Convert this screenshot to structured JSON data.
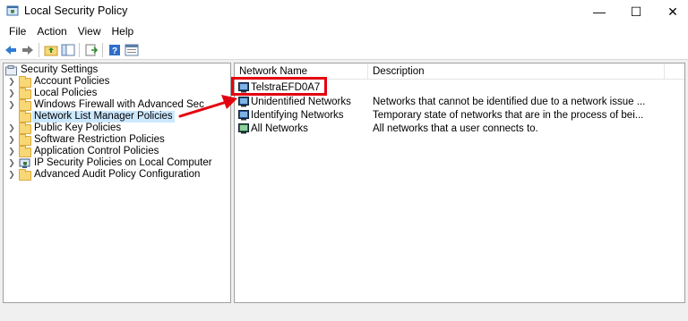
{
  "window": {
    "title": "Local Security Policy",
    "controls": {
      "minimize": "—",
      "maximize": "☐",
      "close": "✕"
    }
  },
  "menu": [
    "File",
    "Action",
    "View",
    "Help"
  ],
  "toolbar": {
    "buttons": [
      "back-arrow-icon",
      "forward-arrow-icon",
      "up-folder-icon",
      "show-hide-tree-icon",
      "export-list-icon",
      "help-icon",
      "properties-icon"
    ]
  },
  "tree": {
    "root": "Security Settings",
    "items": [
      "Account Policies",
      "Local Policies",
      "Windows Firewall with Advanced Sec",
      "Network List Manager Policies",
      "Public Key Policies",
      "Software Restriction Policies",
      "Application Control Policies",
      "IP Security Policies on Local Computer",
      "Advanced Audit Policy Configuration"
    ],
    "selected_index": 3
  },
  "list": {
    "columns": [
      "Network Name",
      "Description"
    ],
    "rows": [
      {
        "name": "TelstraEFD0A7",
        "description": ""
      },
      {
        "name": "Unidentified Networks",
        "description": "Networks that cannot be identified due to a network issue ..."
      },
      {
        "name": "Identifying Networks",
        "description": "Temporary state of networks that are in the process of bei..."
      },
      {
        "name": "All Networks",
        "description": "All networks that a user connects to."
      }
    ]
  },
  "annotation": {
    "box_color": "#e3000f",
    "arrow_color": "#e3000f"
  },
  "colors": {
    "selection": "#cce8ff",
    "folder": "#f8d775"
  }
}
